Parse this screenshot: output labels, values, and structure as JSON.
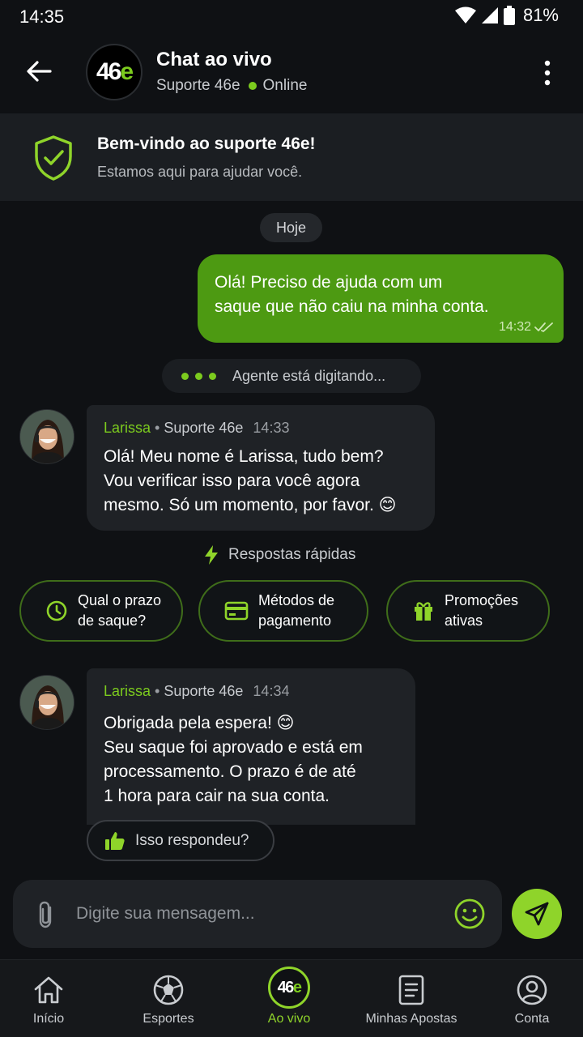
{
  "status_bar": {
    "time": "14:35",
    "battery": "81%"
  },
  "header": {
    "logo": "46e",
    "title": "Chat ao vivo",
    "subtitle": "Suporte 46e",
    "status": "Online"
  },
  "welcome": {
    "title": "Bem-vindo ao suporte 46e!",
    "subtitle": "Estamos aqui para ajudar você."
  },
  "date_chip": "Hoje",
  "messages": {
    "outgoing_1": {
      "line1": "Olá! Preciso de ajuda com um",
      "line2": "saque que não caiu na minha conta.",
      "time": "14:32"
    },
    "typing": "Agente está digitando...",
    "agent_1": {
      "name": "Larissa",
      "separator": "•",
      "role": "Suporte 46e",
      "time": "14:33",
      "line1": "Olá! Meu nome é Larissa, tudo bem?",
      "line2": "Vou verificar isso para você agora",
      "line3": "mesmo. Só um momento, por favor. 😊"
    },
    "agent_2": {
      "name": "Larissa",
      "separator": "•",
      "role": "Suporte 46e",
      "time": "14:34",
      "line1": "Obrigada pela espera! 😊",
      "line2": "Seu saque foi aprovado e está em",
      "line3": "processamento. O prazo é de até",
      "line4": "1 hora para cair na sua conta."
    }
  },
  "quick_replies": {
    "header": "Respostas rápidas",
    "items": [
      {
        "line1": "Qual o prazo",
        "line2": "de saque?",
        "icon": "clock-icon"
      },
      {
        "line1": "Métodos de",
        "line2": "pagamento",
        "icon": "card-icon"
      },
      {
        "line1": "Promoções",
        "line2": "ativas",
        "icon": "gift-icon"
      }
    ]
  },
  "feedback": {
    "label": "Isso respondeu?",
    "icon": "thumbs-up-icon"
  },
  "composer": {
    "placeholder": "Digite sua mensagem..."
  },
  "nav": {
    "items": [
      {
        "label": "Início",
        "icon": "home-icon"
      },
      {
        "label": "Esportes",
        "icon": "soccer-ball-icon"
      },
      {
        "label": "Ao vivo",
        "icon": "live-logo-icon"
      },
      {
        "label": "Minhas Apostas",
        "icon": "document-icon"
      },
      {
        "label": "Conta",
        "icon": "user-icon"
      }
    ],
    "active": "Ao vivo"
  },
  "colors": {
    "background": "#0f1114",
    "accent": "#8fd42a",
    "outgoing_bubble": "#4d9a12",
    "incoming_bubble": "#1f2226"
  }
}
